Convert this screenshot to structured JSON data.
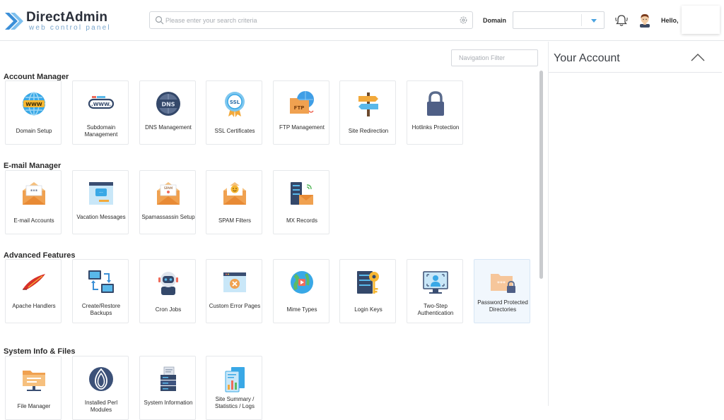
{
  "header": {
    "brand": "DirectAdmin",
    "brand_sub": "web control panel",
    "search_placeholder": "Please enter your search criteria",
    "domain_label": "Domain",
    "domain_value": "",
    "greeting": "Hello, "
  },
  "nav_filter": {
    "placeholder": "Navigation Filter"
  },
  "account_panel": {
    "title": "Your Account"
  },
  "sections": [
    {
      "title": "Account Manager",
      "items": [
        {
          "label": "Domain Setup",
          "icon": "globe-www-icon"
        },
        {
          "label": "Subdomain Management",
          "icon": "subdomain-icon"
        },
        {
          "label": "DNS Management",
          "icon": "dns-icon"
        },
        {
          "label": "SSL Certificates",
          "icon": "ssl-badge-icon"
        },
        {
          "label": "FTP Management",
          "icon": "ftp-folder-icon"
        },
        {
          "label": "Site Redirection",
          "icon": "signpost-icon"
        },
        {
          "label": "Hotlinks Protection",
          "icon": "padlock-icon"
        }
      ]
    },
    {
      "title": "E-mail Manager",
      "items": [
        {
          "label": "E-mail Accounts",
          "icon": "email-envelope-icon"
        },
        {
          "label": "Vacation Messages",
          "icon": "vacation-message-icon"
        },
        {
          "label": "Spamassassin Setup",
          "icon": "spam-envelope-icon"
        },
        {
          "label": "SPAM Filters",
          "icon": "smiley-envelope-icon"
        },
        {
          "label": "MX Records",
          "icon": "mx-server-icon"
        }
      ]
    },
    {
      "title": "Advanced Features",
      "items": [
        {
          "label": "Apache Handlers",
          "icon": "apache-feather-icon"
        },
        {
          "label": "Create/Restore Backups",
          "icon": "backup-monitors-icon"
        },
        {
          "label": "Cron Jobs",
          "icon": "robot-icon"
        },
        {
          "label": "Custom Error Pages",
          "icon": "error-page-icon"
        },
        {
          "label": "Mime Types",
          "icon": "mime-globe-icon"
        },
        {
          "label": "Login Keys",
          "icon": "login-key-icon"
        },
        {
          "label": "Two-Step Authentication",
          "icon": "face-scan-icon"
        },
        {
          "label": "Password Protected Directories",
          "icon": "locked-folder-icon"
        }
      ]
    },
    {
      "title": "System Info & Files",
      "items": [
        {
          "label": "File Manager",
          "icon": "file-folder-icon"
        },
        {
          "label": "Installed Perl Modules",
          "icon": "perl-onion-icon"
        },
        {
          "label": "System Information",
          "icon": "system-server-icon"
        },
        {
          "label": "Site Summary / Statistics / Logs",
          "icon": "site-summary-icon"
        }
      ]
    }
  ],
  "colors": {
    "accent": "#4aa3e0",
    "active_tile": "#f1f7fd",
    "border": "#e6e8eb"
  }
}
